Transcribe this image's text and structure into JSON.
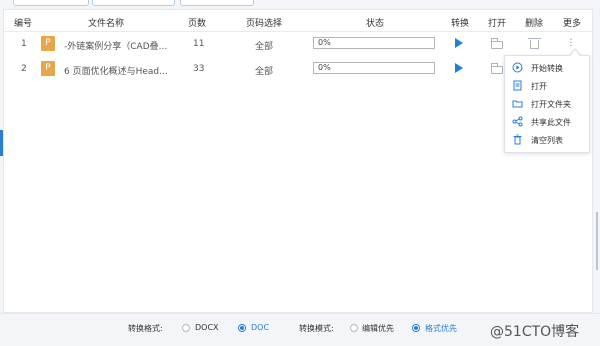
{
  "table": {
    "headers": [
      "编号",
      "文件名称",
      "页数",
      "页码选择",
      "状态",
      "转换",
      "打开",
      "删除",
      "更多"
    ],
    "rows": [
      {
        "index": "1",
        "file_type": "P",
        "file_name": "-外链案例分享（CAD叠...",
        "pages": "11",
        "page_range": "全部",
        "progress": "0%"
      },
      {
        "index": "2",
        "file_type": "P",
        "file_name": "6  页面优化概述与Head...",
        "pages": "33",
        "page_range": "全部",
        "progress": "0%"
      }
    ]
  },
  "context_menu": {
    "items": [
      {
        "icon": "play-circle-icon",
        "label": "开始转换"
      },
      {
        "icon": "document-icon",
        "label": "打开"
      },
      {
        "icon": "folder-open-icon",
        "label": "打开文件夹"
      },
      {
        "icon": "share-icon",
        "label": "共享此文件"
      },
      {
        "icon": "trash-icon",
        "label": "清空列表"
      }
    ]
  },
  "bottom": {
    "format_label": "转换格式:",
    "format_options": [
      "DOCX",
      "DOC"
    ],
    "format_selected": "DOC",
    "mode_label": "转换模式:",
    "mode_options": [
      "编辑优先",
      "格式优先"
    ],
    "mode_selected": "格式优先",
    "watermark": "@51CTO博客"
  },
  "colors": {
    "accent": "#2a7fd4",
    "file_icon": "#e8a64a",
    "play": "#1f7fe0"
  }
}
